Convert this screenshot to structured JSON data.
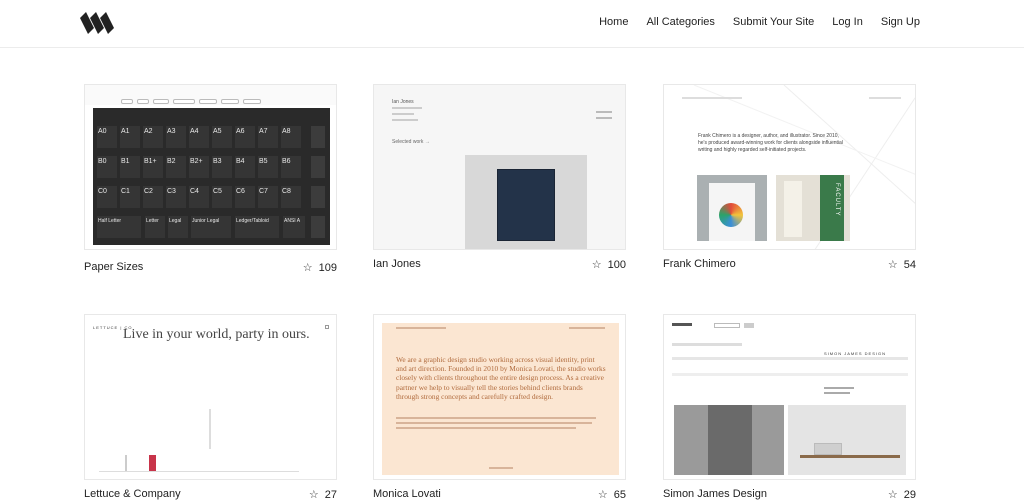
{
  "nav": {
    "items": [
      "Home",
      "All Categories",
      "Submit Your Site",
      "Log In",
      "Sign Up"
    ]
  },
  "cards": [
    {
      "title": "Paper Sizes",
      "stars": "109"
    },
    {
      "title": "Ian Jones",
      "stars": "100"
    },
    {
      "title": "Frank Chimero",
      "stars": "54"
    },
    {
      "title": "Lettuce & Company",
      "stars": "27"
    },
    {
      "title": "Monica Lovati",
      "stars": "65"
    },
    {
      "title": "Simon James Design",
      "stars": "29"
    }
  ],
  "thumbs": {
    "paper_sizes": {
      "rows": [
        [
          "A0",
          "A1",
          "A2",
          "A3",
          "A4",
          "A5",
          "A6",
          "A7",
          "A8"
        ],
        [
          "B0",
          "B1",
          "B1+",
          "B2",
          "B2+",
          "B3",
          "B4",
          "B5",
          "B6"
        ],
        [
          "C0",
          "C1",
          "C2",
          "C3",
          "C4",
          "C5",
          "C6",
          "C7",
          "C8"
        ],
        [
          "Half Letter",
          "Letter",
          "Legal",
          "Junior Legal",
          "Ledger/Tabloid",
          "ANSI A"
        ]
      ]
    },
    "lettuce": {
      "brand": "LETTUCE | CO",
      "headline": "Live in your world, party in ours."
    },
    "frank": {
      "intro": "Frank Chimero is a designer, author, and illustrator. Since 2010, he's produced award-winning work for clients alongside influential writing and highly regarded self-initiated projects.",
      "book_label": "FACULTY"
    },
    "monica": {
      "intro": "We are a graphic design studio working across visual identity, print and art direction. Founded in 2010 by Monica Lovati, the studio works closely with clients throughout the entire design process. As a creative partner we help to visually tell the stories behind clients brands through strong concepts and carefully crafted design."
    },
    "simon": {
      "brand": "SIMON JAMES DESIGN"
    },
    "ian": {
      "name": "Ian Jones",
      "selected": "Selected work →"
    }
  },
  "colors": {
    "accent_red": "#c8344a",
    "monica_bg": "#fbe6d2",
    "paper_dark": "#2a2a2a"
  }
}
